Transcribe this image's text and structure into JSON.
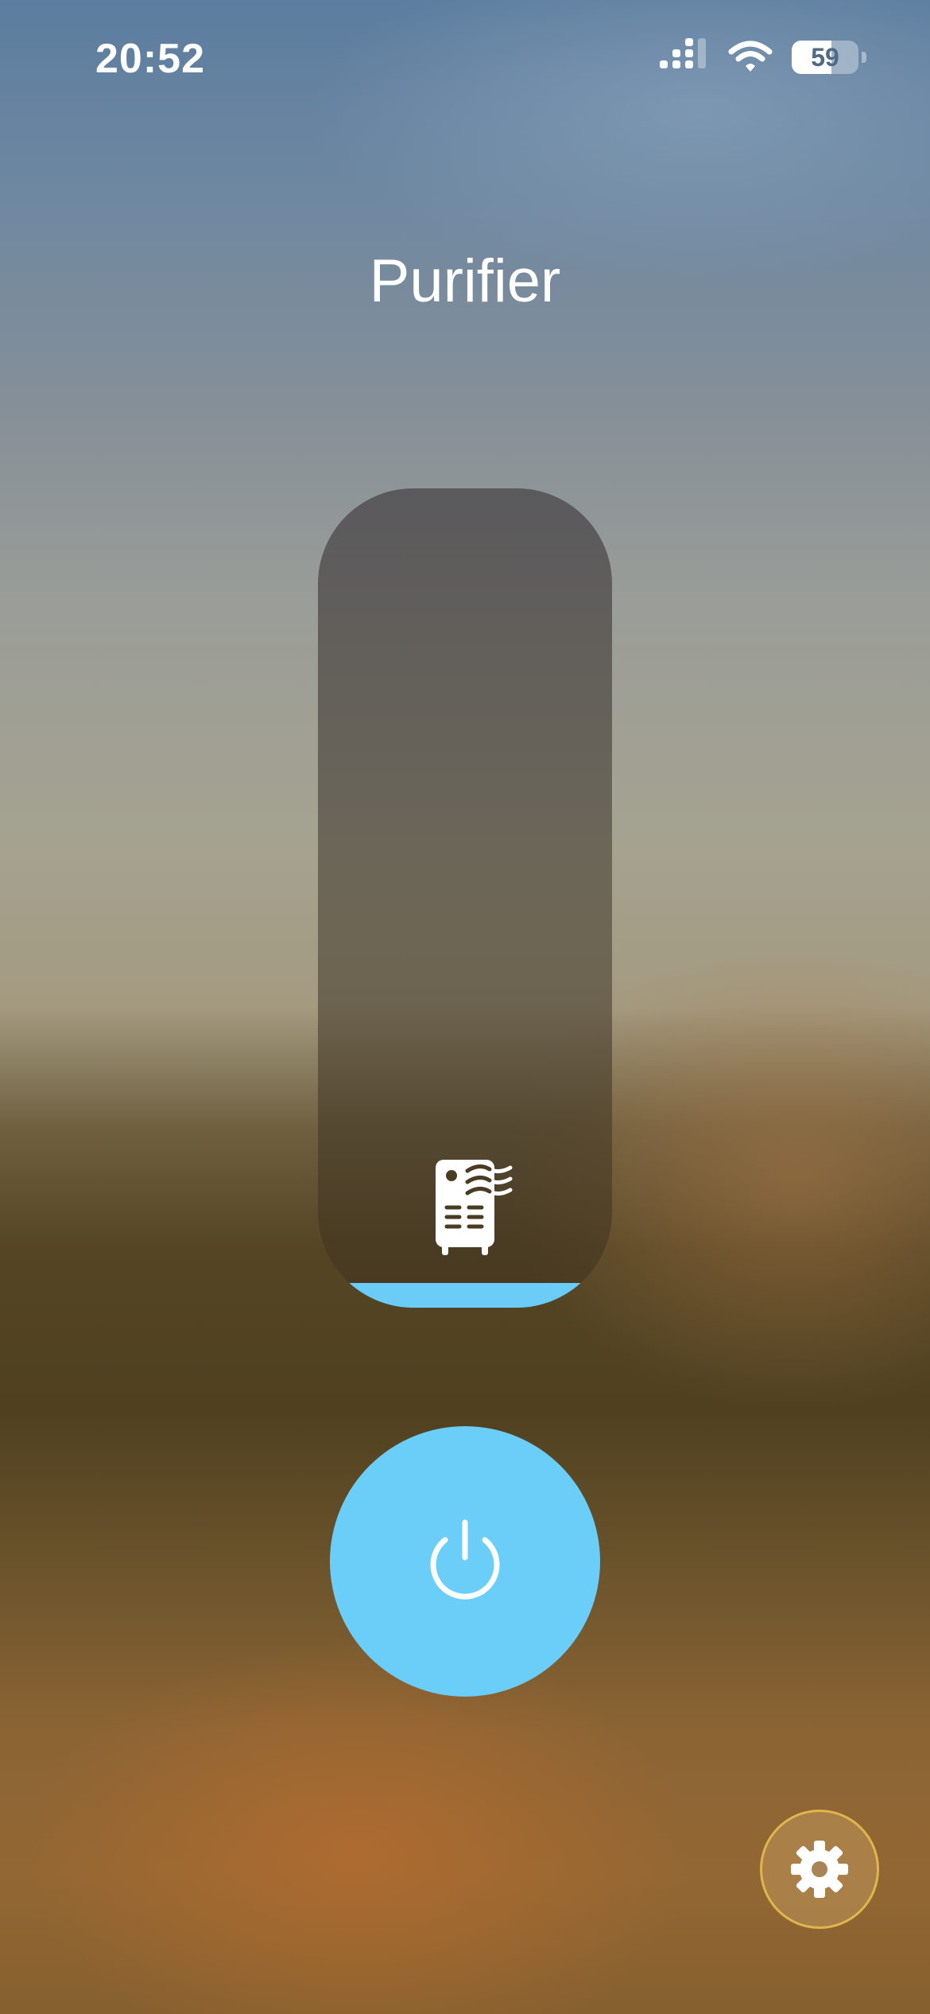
{
  "status_bar": {
    "time": "20:52",
    "battery_percent": "59",
    "battery_level": 0.59,
    "icons": [
      "cellular-signal-icon",
      "wifi-icon",
      "battery-icon"
    ]
  },
  "header": {
    "title": "Purifier"
  },
  "control": {
    "device_icon": "air-purifier-icon",
    "level_fraction": 0.03,
    "accent_color": "#6bcdf7"
  },
  "power": {
    "icon": "power-icon",
    "color": "#6bcef8"
  },
  "settings": {
    "icon": "gear-icon",
    "border_color": "#e1b54d"
  }
}
